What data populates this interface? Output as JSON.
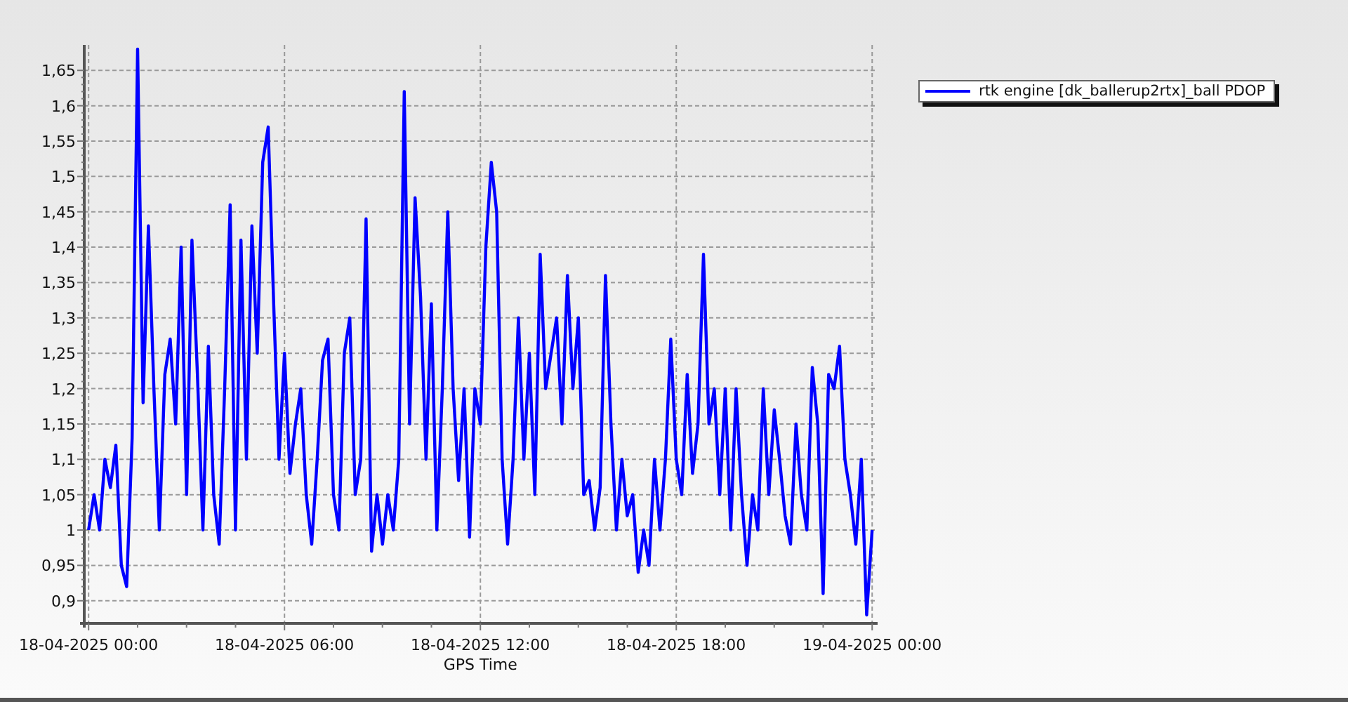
{
  "chart": {
    "chart_data": {
      "type": "line",
      "grid": true,
      "xlabel": "GPS Time",
      "ylim": [
        0.868,
        1.686
      ],
      "categories": [
        "18-04-2025 00:00",
        null,
        null,
        null,
        null,
        null,
        null,
        null,
        null,
        null,
        null,
        null,
        null,
        null,
        null,
        null,
        null,
        null,
        null,
        null,
        null,
        null,
        null,
        null,
        null,
        null,
        null,
        null,
        null,
        null,
        null,
        null,
        null,
        null,
        null,
        null,
        "18-04-2025 06:00",
        null,
        null,
        null,
        null,
        null,
        null,
        null,
        null,
        null,
        null,
        null,
        null,
        null,
        null,
        null,
        null,
        null,
        null,
        null,
        null,
        null,
        null,
        null,
        null,
        null,
        null,
        null,
        null,
        null,
        null,
        null,
        null,
        null,
        null,
        null,
        "18-04-2025 12:00",
        null,
        null,
        null,
        null,
        null,
        null,
        null,
        null,
        null,
        null,
        null,
        null,
        null,
        null,
        null,
        null,
        null,
        null,
        null,
        null,
        null,
        null,
        null,
        null,
        null,
        null,
        null,
        null,
        null,
        null,
        null,
        null,
        null,
        null,
        null,
        "18-04-2025 18:00",
        null,
        null,
        null,
        null,
        null,
        null,
        null,
        null,
        null,
        null,
        null,
        null,
        null,
        null,
        null,
        null,
        null,
        null,
        null,
        null,
        null,
        null,
        null,
        null,
        null,
        null,
        null,
        null,
        null,
        null,
        null,
        null,
        null,
        null,
        null,
        "19-04-2025 00:00"
      ],
      "yticks": [
        {
          "value": 0.9,
          "label": "0,9"
        },
        {
          "value": 0.95,
          "label": "0,95"
        },
        {
          "value": 1,
          "label": "1"
        },
        {
          "value": 1.05,
          "label": "1,05"
        },
        {
          "value": 1.1,
          "label": "1,1"
        },
        {
          "value": 1.15,
          "label": "1,15"
        },
        {
          "value": 1.2,
          "label": "1,2"
        },
        {
          "value": 1.25,
          "label": "1,25"
        },
        {
          "value": 1.3,
          "label": "1,3"
        },
        {
          "value": 1.35,
          "label": "1,35"
        },
        {
          "value": 1.4,
          "label": "1,4"
        },
        {
          "value": 1.45,
          "label": "1,45"
        },
        {
          "value": 1.5,
          "label": "1,5"
        },
        {
          "value": 1.55,
          "label": "1,55"
        },
        {
          "value": 1.6,
          "label": "1,6"
        },
        {
          "value": 1.65,
          "label": "1,65"
        }
      ],
      "series": [
        {
          "name": "rtk engine [dk_ballerup2rtx]_ball PDOP",
          "color": "#0000ff",
          "values": [
            1.0,
            1.05,
            1.0,
            1.1,
            1.06,
            1.12,
            0.95,
            0.92,
            1.13,
            1.68,
            1.18,
            1.43,
            1.2,
            1.0,
            1.22,
            1.27,
            1.15,
            1.4,
            1.05,
            1.41,
            1.22,
            1.0,
            1.26,
            1.05,
            0.98,
            1.2,
            1.46,
            1.0,
            1.41,
            1.1,
            1.43,
            1.25,
            1.52,
            1.57,
            1.32,
            1.1,
            1.25,
            1.08,
            1.15,
            1.2,
            1.05,
            0.98,
            1.1,
            1.24,
            1.27,
            1.05,
            1.0,
            1.25,
            1.3,
            1.05,
            1.1,
            1.44,
            0.97,
            1.05,
            0.98,
            1.05,
            1.0,
            1.1,
            1.62,
            1.15,
            1.47,
            1.33,
            1.1,
            1.32,
            1.0,
            1.2,
            1.45,
            1.2,
            1.07,
            1.2,
            0.99,
            1.2,
            1.15,
            1.4,
            1.52,
            1.45,
            1.1,
            0.98,
            1.1,
            1.3,
            1.1,
            1.25,
            1.05,
            1.39,
            1.2,
            1.25,
            1.3,
            1.15,
            1.36,
            1.2,
            1.3,
            1.05,
            1.07,
            1.0,
            1.06,
            1.36,
            1.15,
            1.0,
            1.1,
            1.02,
            1.05,
            0.94,
            1.0,
            0.95,
            1.1,
            1.0,
            1.1,
            1.27,
            1.1,
            1.05,
            1.22,
            1.08,
            1.15,
            1.39,
            1.15,
            1.2,
            1.05,
            1.2,
            1.0,
            1.2,
            1.05,
            0.95,
            1.05,
            1.0,
            1.2,
            1.05,
            1.17,
            1.1,
            1.02,
            0.98,
            1.15,
            1.05,
            1.0,
            1.23,
            1.15,
            0.91,
            1.22,
            1.2,
            1.26,
            1.1,
            1.05,
            0.98,
            1.1,
            0.88,
            1.0
          ]
        }
      ]
    }
  }
}
